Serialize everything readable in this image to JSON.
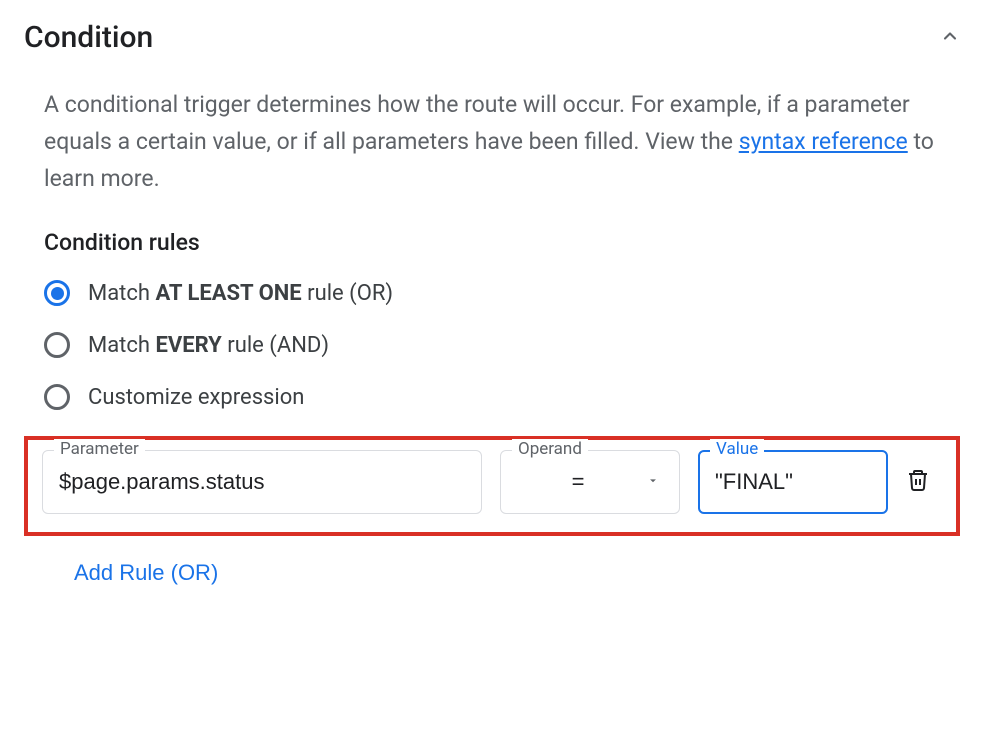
{
  "section": {
    "title": "Condition",
    "description_pre": "A conditional trigger determines how the route will occur. For example, if a parameter equals a certain value, or if all parameters have been filled. View the ",
    "link_text": "syntax reference",
    "description_post": " to learn more."
  },
  "rules": {
    "subtitle": "Condition rules",
    "options": [
      {
        "pre": "Match ",
        "bold": "AT LEAST ONE",
        "post": " rule (OR)",
        "selected": true
      },
      {
        "pre": "Match ",
        "bold": "EVERY",
        "post": " rule (AND)",
        "selected": false
      },
      {
        "pre": "Customize expression",
        "bold": "",
        "post": "",
        "selected": false
      }
    ]
  },
  "rule_row": {
    "parameter_label": "Parameter",
    "parameter_value": "$page.params.status",
    "operand_label": "Operand",
    "operand_value": "=",
    "value_label": "Value",
    "value_value": "\"FINAL\""
  },
  "add_rule_label": "Add Rule (OR)"
}
